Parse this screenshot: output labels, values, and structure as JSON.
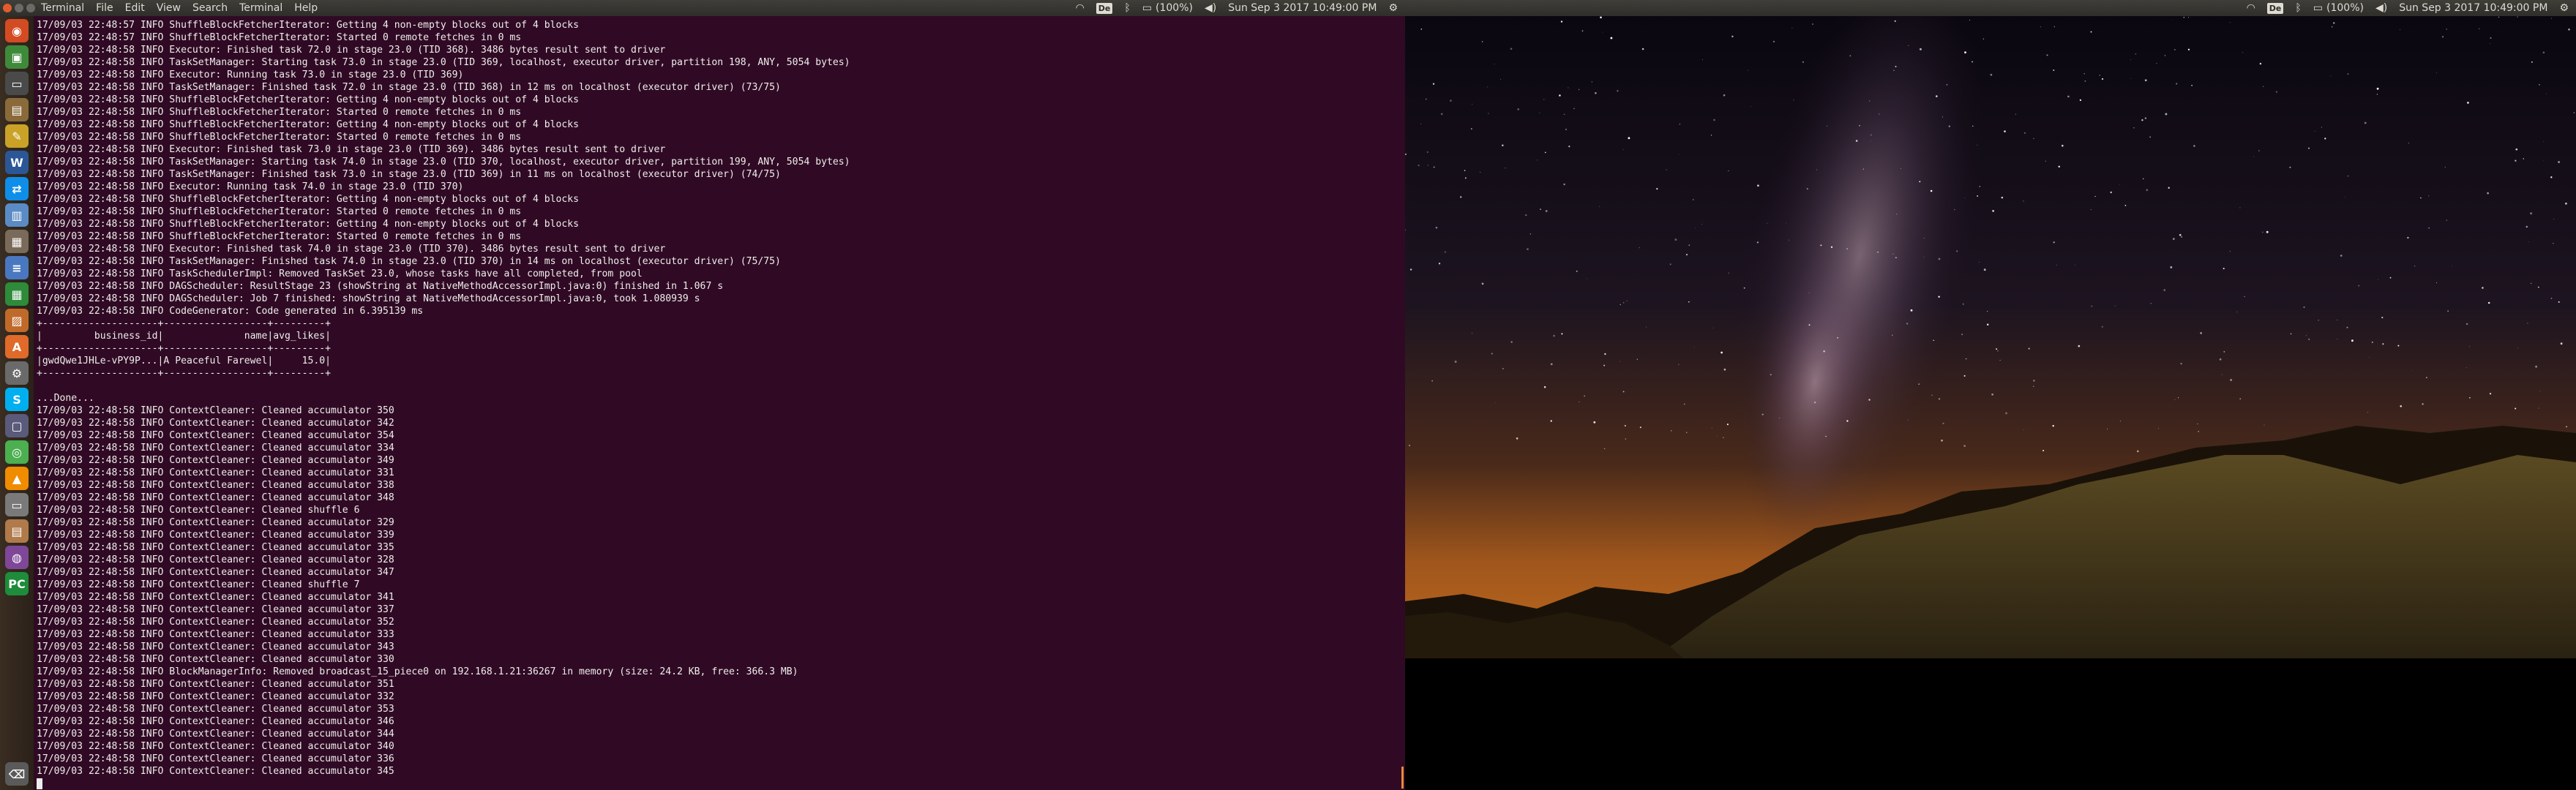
{
  "top_panel_left": {
    "app_title": "Terminal",
    "menus": [
      "File",
      "Edit",
      "View",
      "Search",
      "Terminal",
      "Help"
    ],
    "indicators": {
      "keyboard": "De",
      "battery": "(100%)",
      "datetime": "Sun Sep 3 2017 10:49:00 PM"
    }
  },
  "top_panel_right": {
    "indicators": {
      "keyboard": "De",
      "battery": "(100%)",
      "datetime": "Sun Sep 3 2017 10:49:00 PM"
    }
  },
  "launcher": {
    "items": [
      {
        "name": "ubuntu-dash-icon",
        "glyph": "◉",
        "color": "#d34b23"
      },
      {
        "name": "terminal-green-icon",
        "glyph": "▣",
        "color": "#3f8a3a"
      },
      {
        "name": "monitor-icon",
        "glyph": "▭",
        "color": "#4a4a4a"
      },
      {
        "name": "files-icon",
        "glyph": "▤",
        "color": "#8a6a3a"
      },
      {
        "name": "gimp-icon",
        "glyph": "✎",
        "color": "#c9a227"
      },
      {
        "name": "word-icon",
        "glyph": "W",
        "color": "#2b5797"
      },
      {
        "name": "teamviewer-icon",
        "glyph": "⇄",
        "color": "#0e8ee9"
      },
      {
        "name": "writer-icon",
        "glyph": "▥",
        "color": "#5a8bc4"
      },
      {
        "name": "manager-icon",
        "glyph": "▦",
        "color": "#7a6a5a"
      },
      {
        "name": "texteditor-icon",
        "glyph": "≡",
        "color": "#4a78c0"
      },
      {
        "name": "calc-icon",
        "glyph": "▦",
        "color": "#2e8b3a"
      },
      {
        "name": "impress-icon",
        "glyph": "▨",
        "color": "#c06a2a"
      },
      {
        "name": "software-center-icon",
        "glyph": "A",
        "color": "#e06a2a"
      },
      {
        "name": "settings-icon",
        "glyph": "⚙",
        "color": "#6a6a6a"
      },
      {
        "name": "skype-icon",
        "glyph": "S",
        "color": "#00aff0"
      },
      {
        "name": "vm-icon",
        "glyph": "▢",
        "color": "#5a5a7a"
      },
      {
        "name": "chrome-icon",
        "glyph": "◎",
        "color": "#4caf50"
      },
      {
        "name": "vlc-icon",
        "glyph": "▲",
        "color": "#f08c00"
      },
      {
        "name": "drive-icon",
        "glyph": "▭",
        "color": "#7a7a7a"
      },
      {
        "name": "archive-icon",
        "glyph": "▤",
        "color": "#b07a4a"
      },
      {
        "name": "tor-icon",
        "glyph": "◍",
        "color": "#7e4798"
      },
      {
        "name": "pycharm-icon",
        "glyph": "PC",
        "color": "#1e8c3a"
      },
      {
        "name": "trash-icon",
        "glyph": "⌫",
        "color": "#5a5a5a"
      }
    ]
  },
  "terminal": {
    "lines": [
      "17/09/03 22:48:57 INFO ShuffleBlockFetcherIterator: Getting 4 non-empty blocks out of 4 blocks",
      "17/09/03 22:48:57 INFO ShuffleBlockFetcherIterator: Started 0 remote fetches in 0 ms",
      "17/09/03 22:48:58 INFO Executor: Finished task 72.0 in stage 23.0 (TID 368). 3486 bytes result sent to driver",
      "17/09/03 22:48:58 INFO TaskSetManager: Starting task 73.0 in stage 23.0 (TID 369, localhost, executor driver, partition 198, ANY, 5054 bytes)",
      "17/09/03 22:48:58 INFO Executor: Running task 73.0 in stage 23.0 (TID 369)",
      "17/09/03 22:48:58 INFO TaskSetManager: Finished task 72.0 in stage 23.0 (TID 368) in 12 ms on localhost (executor driver) (73/75)",
      "17/09/03 22:48:58 INFO ShuffleBlockFetcherIterator: Getting 4 non-empty blocks out of 4 blocks",
      "17/09/03 22:48:58 INFO ShuffleBlockFetcherIterator: Started 0 remote fetches in 0 ms",
      "17/09/03 22:48:58 INFO ShuffleBlockFetcherIterator: Getting 4 non-empty blocks out of 4 blocks",
      "17/09/03 22:48:58 INFO ShuffleBlockFetcherIterator: Started 0 remote fetches in 0 ms",
      "17/09/03 22:48:58 INFO Executor: Finished task 73.0 in stage 23.0 (TID 369). 3486 bytes result sent to driver",
      "17/09/03 22:48:58 INFO TaskSetManager: Starting task 74.0 in stage 23.0 (TID 370, localhost, executor driver, partition 199, ANY, 5054 bytes)",
      "17/09/03 22:48:58 INFO TaskSetManager: Finished task 73.0 in stage 23.0 (TID 369) in 11 ms on localhost (executor driver) (74/75)",
      "17/09/03 22:48:58 INFO Executor: Running task 74.0 in stage 23.0 (TID 370)",
      "17/09/03 22:48:58 INFO ShuffleBlockFetcherIterator: Getting 4 non-empty blocks out of 4 blocks",
      "17/09/03 22:48:58 INFO ShuffleBlockFetcherIterator: Started 0 remote fetches in 0 ms",
      "17/09/03 22:48:58 INFO ShuffleBlockFetcherIterator: Getting 4 non-empty blocks out of 4 blocks",
      "17/09/03 22:48:58 INFO ShuffleBlockFetcherIterator: Started 0 remote fetches in 0 ms",
      "17/09/03 22:48:58 INFO Executor: Finished task 74.0 in stage 23.0 (TID 370). 3486 bytes result sent to driver",
      "17/09/03 22:48:58 INFO TaskSetManager: Finished task 74.0 in stage 23.0 (TID 370) in 14 ms on localhost (executor driver) (75/75)",
      "17/09/03 22:48:58 INFO TaskSchedulerImpl: Removed TaskSet 23.0, whose tasks have all completed, from pool",
      "17/09/03 22:48:58 INFO DAGScheduler: ResultStage 23 (showString at NativeMethodAccessorImpl.java:0) finished in 1.067 s",
      "17/09/03 22:48:58 INFO DAGScheduler: Job 7 finished: showString at NativeMethodAccessorImpl.java:0, took 1.080939 s",
      "17/09/03 22:48:58 INFO CodeGenerator: Code generated in 6.395139 ms",
      "+--------------------+------------------+---------+",
      "|         business_id|              name|avg_likes|",
      "+--------------------+------------------+---------+",
      "|gwdQwe1JHLe-vPY9P...|A Peaceful Farewel|     15.0|",
      "+--------------------+------------------+---------+",
      "",
      "...Done...",
      "17/09/03 22:48:58 INFO ContextCleaner: Cleaned accumulator 350",
      "17/09/03 22:48:58 INFO ContextCleaner: Cleaned accumulator 342",
      "17/09/03 22:48:58 INFO ContextCleaner: Cleaned accumulator 354",
      "17/09/03 22:48:58 INFO ContextCleaner: Cleaned accumulator 334",
      "17/09/03 22:48:58 INFO ContextCleaner: Cleaned accumulator 349",
      "17/09/03 22:48:58 INFO ContextCleaner: Cleaned accumulator 331",
      "17/09/03 22:48:58 INFO ContextCleaner: Cleaned accumulator 338",
      "17/09/03 22:48:58 INFO ContextCleaner: Cleaned accumulator 348",
      "17/09/03 22:48:58 INFO ContextCleaner: Cleaned shuffle 6",
      "17/09/03 22:48:58 INFO ContextCleaner: Cleaned accumulator 329",
      "17/09/03 22:48:58 INFO ContextCleaner: Cleaned accumulator 339",
      "17/09/03 22:48:58 INFO ContextCleaner: Cleaned accumulator 335",
      "17/09/03 22:48:58 INFO ContextCleaner: Cleaned accumulator 328",
      "17/09/03 22:48:58 INFO ContextCleaner: Cleaned accumulator 347",
      "17/09/03 22:48:58 INFO ContextCleaner: Cleaned shuffle 7",
      "17/09/03 22:48:58 INFO ContextCleaner: Cleaned accumulator 341",
      "17/09/03 22:48:58 INFO ContextCleaner: Cleaned accumulator 337",
      "17/09/03 22:48:58 INFO ContextCleaner: Cleaned accumulator 352",
      "17/09/03 22:48:58 INFO ContextCleaner: Cleaned accumulator 333",
      "17/09/03 22:48:58 INFO ContextCleaner: Cleaned accumulator 343",
      "17/09/03 22:48:58 INFO ContextCleaner: Cleaned accumulator 330",
      "17/09/03 22:48:58 INFO BlockManagerInfo: Removed broadcast_15_piece0 on 192.168.1.21:36267 in memory (size: 24.2 KB, free: 366.3 MB)",
      "17/09/03 22:48:58 INFO ContextCleaner: Cleaned accumulator 351",
      "17/09/03 22:48:58 INFO ContextCleaner: Cleaned accumulator 332",
      "17/09/03 22:48:58 INFO ContextCleaner: Cleaned accumulator 353",
      "17/09/03 22:48:58 INFO ContextCleaner: Cleaned accumulator 346",
      "17/09/03 22:48:58 INFO ContextCleaner: Cleaned accumulator 344",
      "17/09/03 22:48:58 INFO ContextCleaner: Cleaned accumulator 340",
      "17/09/03 22:48:58 INFO ContextCleaner: Cleaned accumulator 336",
      "17/09/03 22:48:58 INFO ContextCleaner: Cleaned accumulator 345"
    ]
  }
}
